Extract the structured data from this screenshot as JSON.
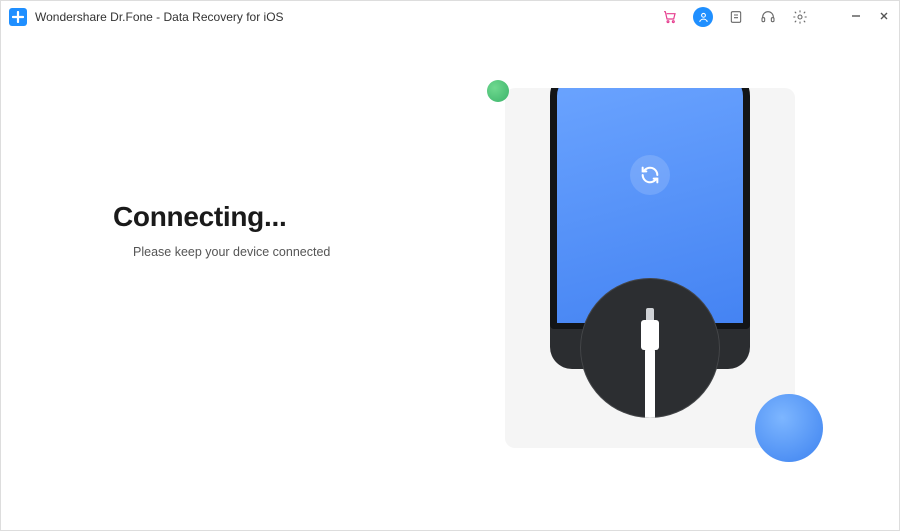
{
  "titlebar": {
    "title": "Wondershare Dr.Fone - Data Recovery for iOS",
    "icons": {
      "app": "plus-icon",
      "cart": "cart-icon",
      "user": "user-icon",
      "feedback": "note-icon",
      "support": "headset-icon",
      "settings": "gear-icon",
      "minimize": "minimize-icon",
      "close": "close-icon"
    }
  },
  "status": {
    "title": "Connecting...",
    "subtitle": "Please keep your device connected"
  },
  "illustration": {
    "sync_icon": "sync-icon",
    "accent_green": "#4cc278",
    "accent_blue": "#4b8af2",
    "phone_bg": "#5a95f7"
  }
}
